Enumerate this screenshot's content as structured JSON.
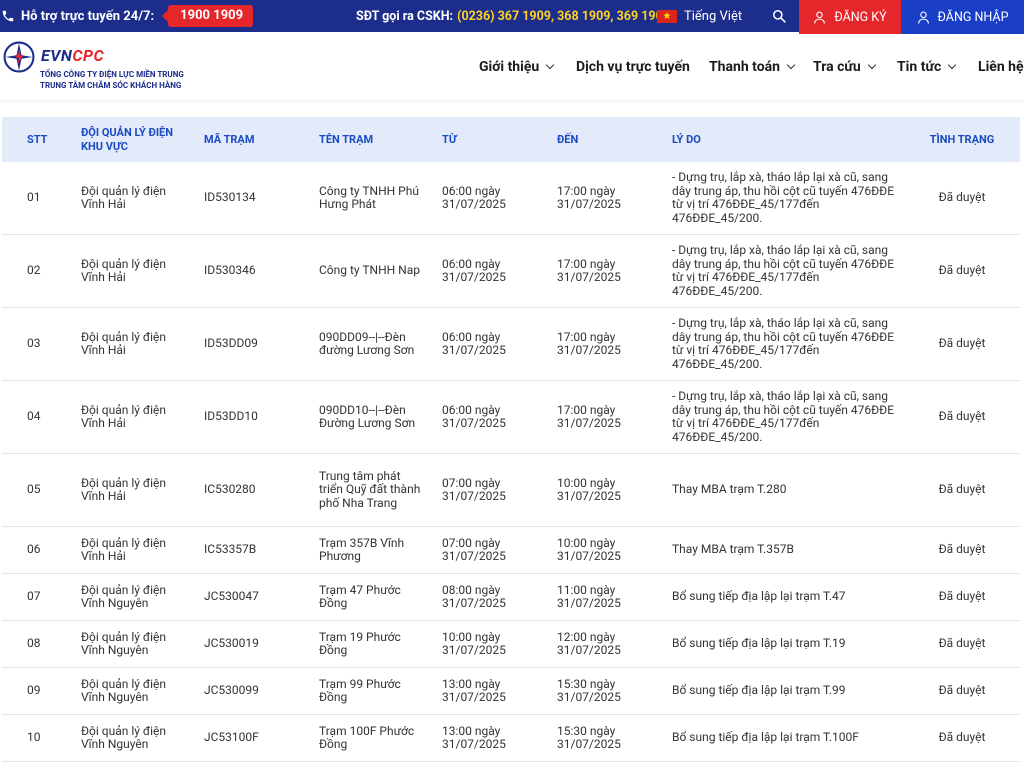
{
  "topbar": {
    "support_label": "Hỗ trợ trực tuyến 24/7:",
    "hotline": "1900 1909",
    "cskh_label": "SĐT gọi ra CSKH:",
    "cskh_numbers": "(0236) 367 1909, 368 1909, 369 1909",
    "language": "Tiếng Việt",
    "register_label": "ĐĂNG KÝ",
    "login_label": "ĐĂNG NHẬP"
  },
  "header": {
    "brand_evn": "EVN",
    "brand_cpc": "CPC",
    "subtitle_1": "TỔNG CÔNG TY ĐIỆN LỰC MIỀN TRUNG",
    "subtitle_2": "TRUNG TÂM CHĂM SÓC KHÁCH HÀNG",
    "nav": [
      {
        "label": "Giới thiệu",
        "has_dropdown": true
      },
      {
        "label": "Dịch vụ trực tuyến",
        "has_dropdown": false
      },
      {
        "label": "Thanh toán",
        "has_dropdown": true
      },
      {
        "label": "Tra cứu",
        "has_dropdown": true
      },
      {
        "label": "Tin tức",
        "has_dropdown": true
      },
      {
        "label": "Liên hệ",
        "has_dropdown": false
      }
    ]
  },
  "table": {
    "headers": {
      "stt": "STT",
      "don_vi": "ĐỘI QUẢN LÝ ĐIỆN KHU VỰC",
      "ma_tram": "MÃ TRẠM",
      "ten_tram": "TÊN TRẠM",
      "tu": "TỪ",
      "den": "ĐẾN",
      "ly_do": "LÝ DO",
      "tinh_trang": "TÌNH TRẠNG"
    },
    "rows": [
      {
        "stt": "01",
        "don_vi": "Đội quản lý điện Vĩnh Hải",
        "ma_tram": "ID530134",
        "ten_tram": "Công ty TNHH Phú Hưng Phát",
        "tu": "06:00 ngày 31/07/2025",
        "den": "17:00 ngày 31/07/2025",
        "ly_do": "- Dựng trụ, lắp xà, tháo lắp lại xà cũ, sang dây trung áp, thu hồi cột cũ tuyến 476ĐĐE từ vị trí 476ĐĐE_45/177đến 476ĐĐE_45/200.",
        "tinh_trang": "Đã duyệt"
      },
      {
        "stt": "02",
        "don_vi": "Đội quản lý điện Vĩnh Hải",
        "ma_tram": "ID530346",
        "ten_tram": "Công ty TNHH Nap",
        "tu": "06:00 ngày 31/07/2025",
        "den": "17:00 ngày 31/07/2025",
        "ly_do": "- Dựng trụ, lắp xà, tháo lắp lại xà cũ, sang dây trung áp, thu hồi cột cũ tuyến 476ĐĐE từ vị trí 476ĐĐE_45/177đến 476ĐĐE_45/200.",
        "tinh_trang": "Đã duyệt"
      },
      {
        "stt": "03",
        "don_vi": "Đội quản lý điện Vĩnh Hải",
        "ma_tram": "ID53DD09",
        "ten_tram": "090DD09--|--Đèn đường Lương Sơn",
        "tu": "06:00 ngày 31/07/2025",
        "den": "17:00 ngày 31/07/2025",
        "ly_do": "- Dựng trụ, lắp xà, tháo lắp lại xà cũ, sang dây trung áp, thu hồi cột cũ tuyến 476ĐĐE từ vị trí 476ĐĐE_45/177đến 476ĐĐE_45/200.",
        "tinh_trang": "Đã duyệt"
      },
      {
        "stt": "04",
        "don_vi": "Đội quản lý điện Vĩnh Hải",
        "ma_tram": "ID53DD10",
        "ten_tram": "090DD10--|--Đèn Đường Lương Sơn",
        "tu": "06:00 ngày 31/07/2025",
        "den": "17:00 ngày 31/07/2025",
        "ly_do": "- Dựng trụ, lắp xà, tháo lắp lại xà cũ, sang dây trung áp, thu hồi cột cũ tuyến 476ĐĐE từ vị trí 476ĐĐE_45/177đến 476ĐĐE_45/200.",
        "tinh_trang": "Đã duyệt"
      },
      {
        "stt": "05",
        "don_vi": "Đội quản lý điện Vĩnh Hải",
        "ma_tram": "IC530280",
        "ten_tram": "Trung tâm phát triển Quỹ đất thành phố Nha Trang",
        "tu": "07:00 ngày 31/07/2025",
        "den": "10:00 ngày 31/07/2025",
        "ly_do": "Thay MBA trạm T.280",
        "tinh_trang": "Đã duyệt"
      },
      {
        "stt": "06",
        "don_vi": "Đội quản lý điện Vĩnh Hải",
        "ma_tram": "IC53357B",
        "ten_tram": "Trạm 357B Vĩnh Phương",
        "tu": "07:00 ngày 31/07/2025",
        "den": "10:00 ngày 31/07/2025",
        "ly_do": "Thay MBA trạm T.357B",
        "tinh_trang": "Đã duyệt"
      },
      {
        "stt": "07",
        "don_vi": "Đội quản lý điện Vĩnh Nguyên",
        "ma_tram": "JC530047",
        "ten_tram": "Trạm 47 Phước Đồng",
        "tu": "08:00 ngày 31/07/2025",
        "den": "11:00 ngày 31/07/2025",
        "ly_do": "Bổ sung tiếp địa lập lại trạm T.47",
        "tinh_trang": "Đã duyệt"
      },
      {
        "stt": "08",
        "don_vi": "Đội quản lý điện Vĩnh Nguyên",
        "ma_tram": "JC530019",
        "ten_tram": "Trạm 19 Phước Đồng",
        "tu": "10:00 ngày 31/07/2025",
        "den": "12:00 ngày 31/07/2025",
        "ly_do": "Bổ sung tiếp địa lập lại trạm T.19",
        "tinh_trang": "Đã duyệt"
      },
      {
        "stt": "09",
        "don_vi": "Đội quản lý điện Vĩnh Nguyên",
        "ma_tram": "JC530099",
        "ten_tram": "Trạm 99 Phước Đồng",
        "tu": "13:00 ngày 31/07/2025",
        "den": "15:30 ngày 31/07/2025",
        "ly_do": "Bổ sung tiếp địa lập lại trạm T.99",
        "tinh_trang": "Đã duyệt"
      },
      {
        "stt": "10",
        "don_vi": "Đội quản lý điện Vĩnh Nguyên",
        "ma_tram": "JC53100F",
        "ten_tram": "Trạm 100F Phước Đồng",
        "tu": "13:00 ngày 31/07/2025",
        "den": "15:30 ngày 31/07/2025",
        "ly_do": "Bổ sung tiếp địa lập lại trạm T.100F",
        "tinh_trang": "Đã duyệt"
      }
    ]
  }
}
